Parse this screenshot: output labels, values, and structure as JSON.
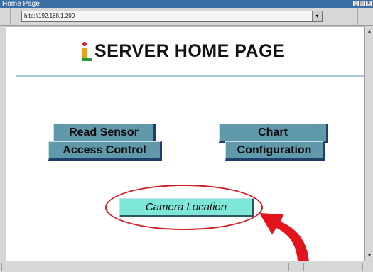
{
  "window": {
    "title": "Home Page",
    "buttons": [
      "_",
      "□",
      "x"
    ]
  },
  "address": {
    "url": "http://192.168.1.200",
    "dropdown_glyph": "▾"
  },
  "page": {
    "logo_letter": "i",
    "title": "SERVER HOME PAGE",
    "buttons": {
      "read_sensor": "Read Sensor",
      "chart": "Chart",
      "access_control": "Access Control",
      "configuration": "Configuration",
      "camera_location": "Camera Location"
    }
  },
  "colors": {
    "button_fill": "#5f99aa",
    "camera_button_fill": "#7de8d8",
    "highlight_ring": "#d32027",
    "pointer_arrow": "#e3141c",
    "logo_stem": "#e8a020",
    "logo_dot": "#d21f1f",
    "logo_base": "#2a9a3a",
    "divider": "#a9c8d6"
  },
  "icons": {
    "logo": "i-logo-icon",
    "pointer": "curved-arrow-icon",
    "highlight": "ellipse-highlight"
  }
}
